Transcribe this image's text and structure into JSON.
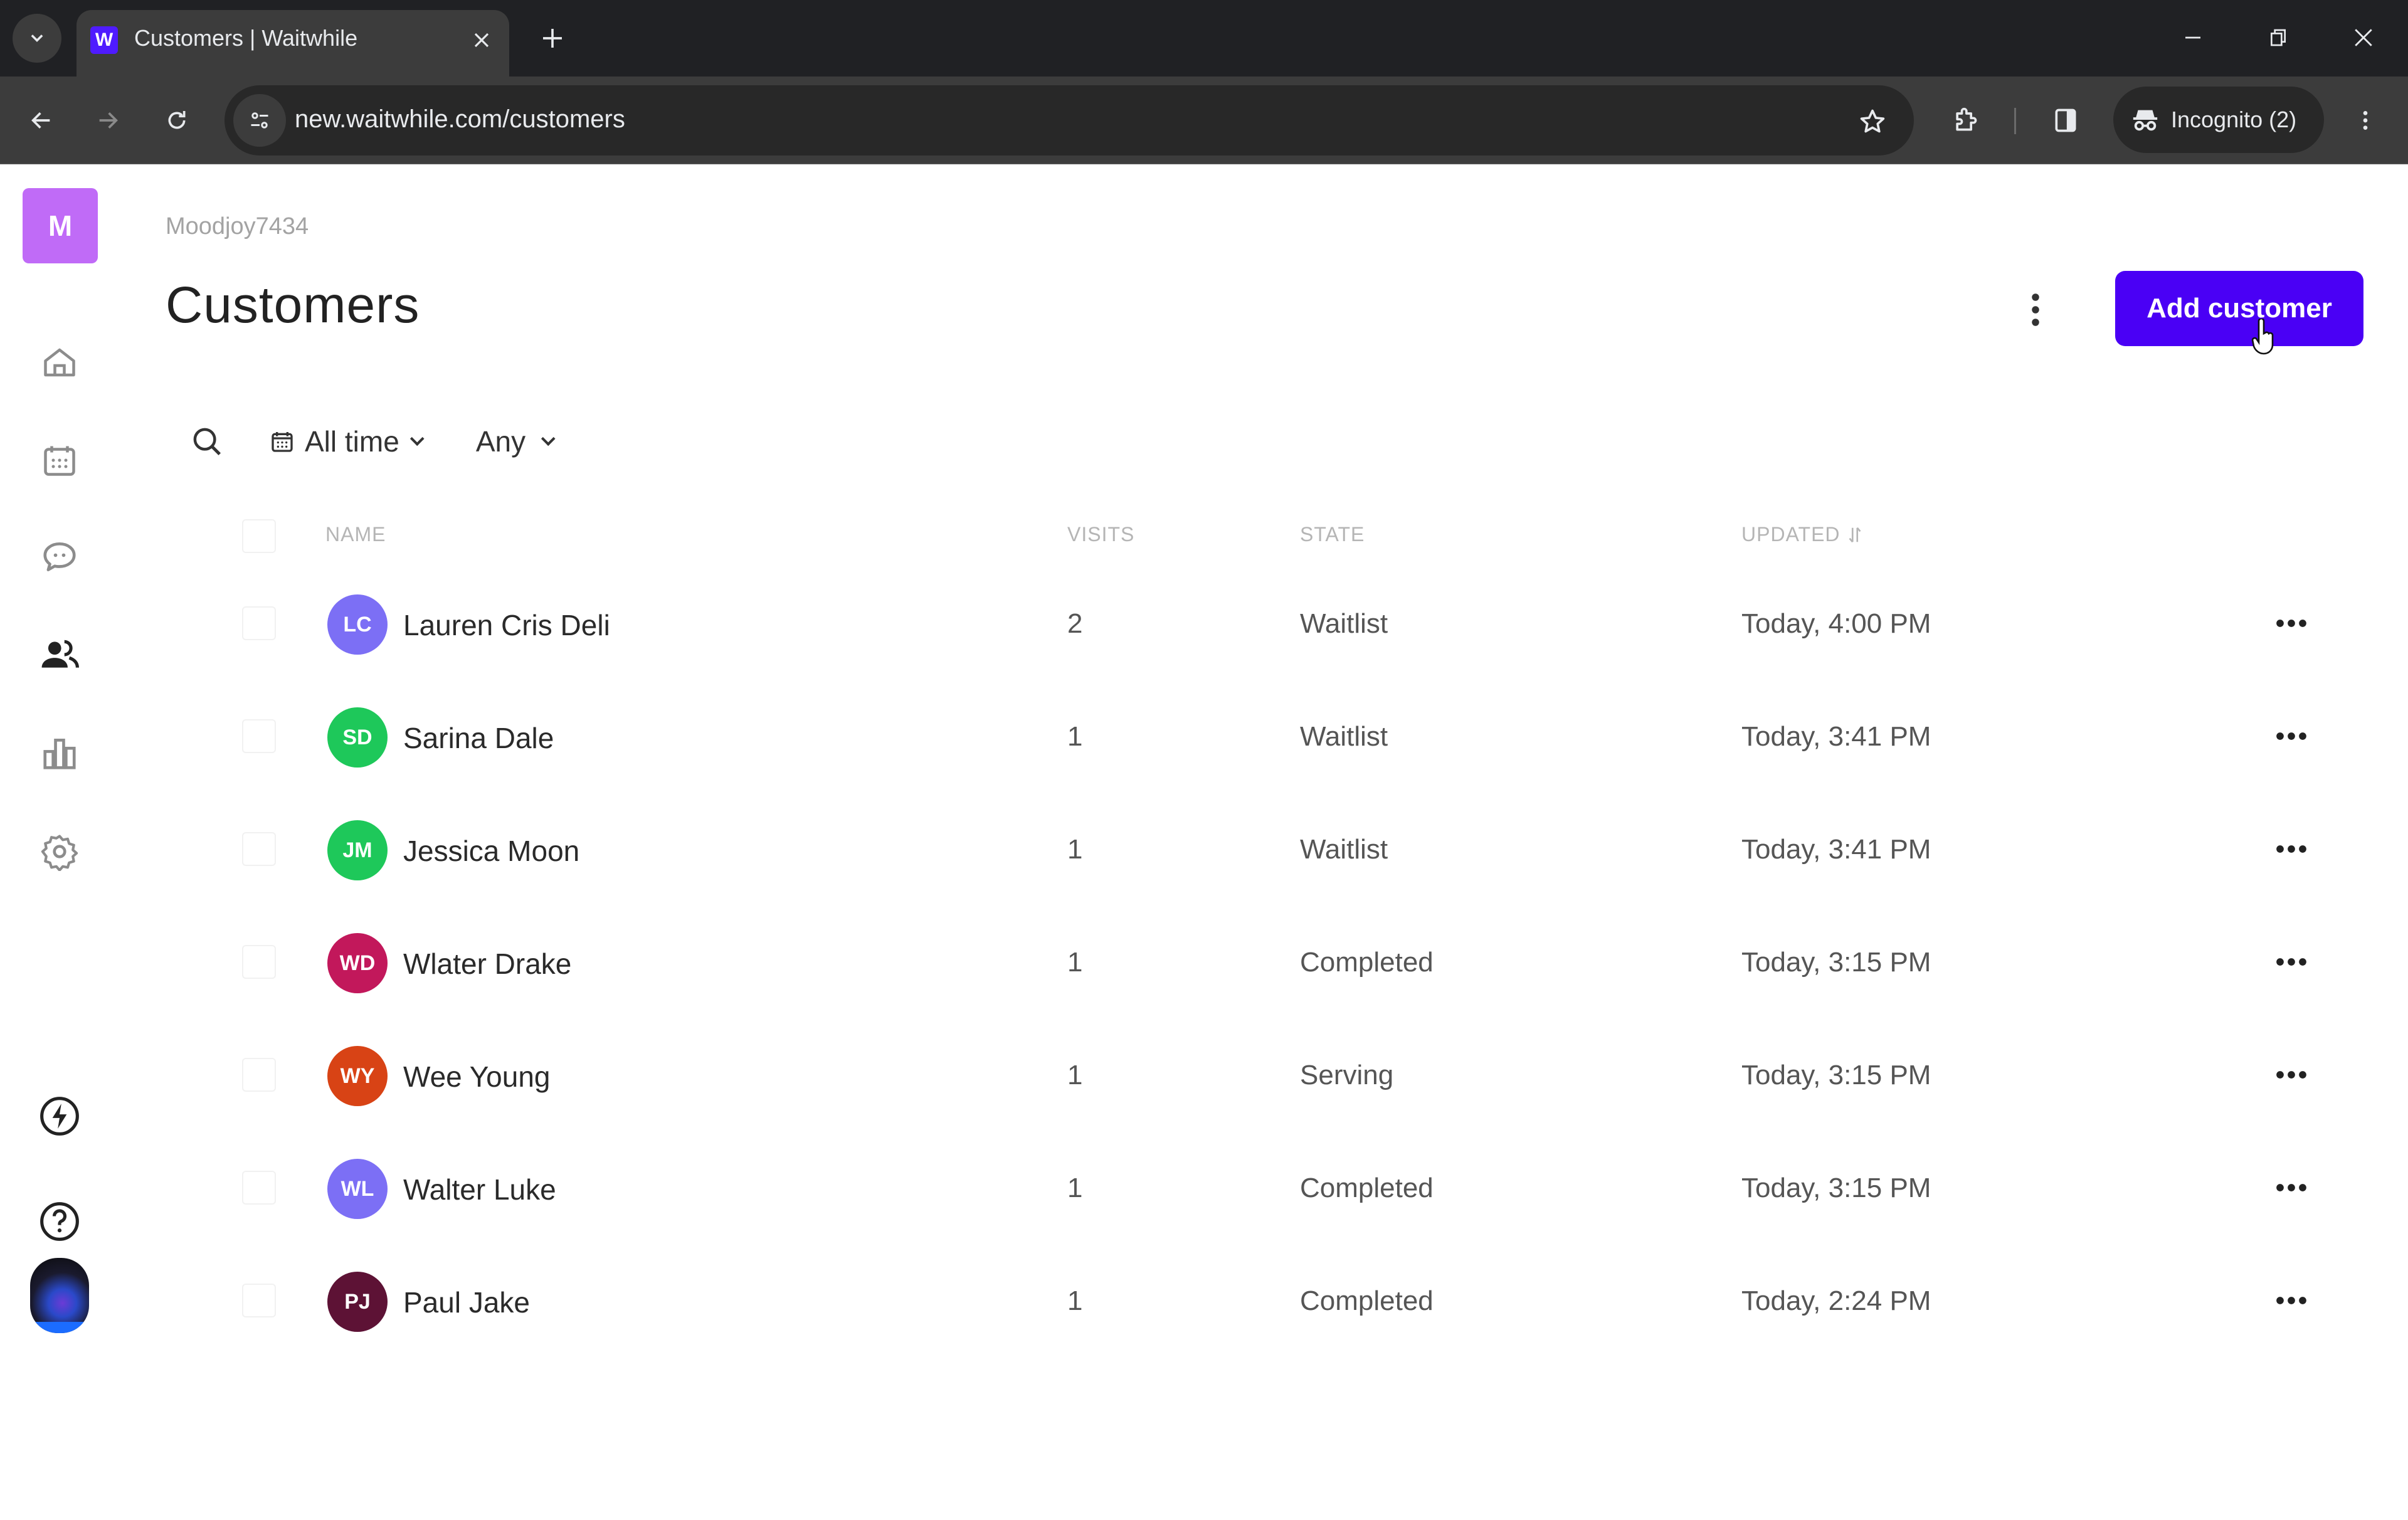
{
  "browser": {
    "tab_title": "Customers | Waitwhile",
    "tab_favicon_letter": "W",
    "url": "new.waitwhile.com/customers",
    "incognito_label": "Incognito (2)",
    "icons": {
      "tab_list": "chevron-down-icon",
      "tab_close": "close-icon",
      "new_tab": "plus-icon",
      "back": "arrow-left-icon",
      "forward": "arrow-right-icon",
      "reload": "reload-icon",
      "site_info": "tune-icon",
      "bookmark": "star-icon",
      "extensions": "puzzle-icon",
      "side_panel": "side-panel-icon",
      "incognito": "incognito-icon",
      "menu": "kebab-icon",
      "minimize": "minimize-icon",
      "restore": "restore-icon",
      "close": "close-icon"
    }
  },
  "sidebar": {
    "org_initial": "M",
    "org_color": "#c06bf7",
    "items": [
      {
        "id": "home",
        "icon": "home-icon",
        "active": false
      },
      {
        "id": "calendar",
        "icon": "calendar-icon",
        "active": false
      },
      {
        "id": "messages",
        "icon": "chat-icon",
        "active": false
      },
      {
        "id": "customers",
        "icon": "users-icon",
        "active": true
      },
      {
        "id": "analytics",
        "icon": "bar-chart-icon",
        "active": false
      },
      {
        "id": "settings",
        "icon": "gear-icon",
        "active": false
      }
    ],
    "bottom_items": [
      {
        "id": "whats-new",
        "icon": "lightning-icon"
      },
      {
        "id": "help",
        "icon": "help-icon"
      },
      {
        "id": "profile",
        "icon": "avatar"
      }
    ]
  },
  "header": {
    "org_name": "Moodjoy7434",
    "title": "Customers",
    "more_icon": "kebab-icon",
    "add_button_label": "Add customer",
    "accent_color": "#4a00f5"
  },
  "filters": {
    "search_icon": "search-icon",
    "date_filter": "All time",
    "state_filter": "Any"
  },
  "table": {
    "columns": {
      "name": "NAME",
      "visits": "VISITS",
      "state": "STATE",
      "updated": "UPDATED"
    },
    "sort_icon": "sort-icon",
    "rows": [
      {
        "initials": "LC",
        "color": "#7c6ff5",
        "name": "Lauren Cris Deli",
        "visits": "2",
        "state": "Waitlist",
        "updated": "Today, 4:00 PM"
      },
      {
        "initials": "SD",
        "color": "#1ec85a",
        "name": "Sarina Dale",
        "visits": "1",
        "state": "Waitlist",
        "updated": "Today, 3:41 PM"
      },
      {
        "initials": "JM",
        "color": "#1ec85a",
        "name": "Jessica Moon",
        "visits": "1",
        "state": "Waitlist",
        "updated": "Today, 3:41 PM"
      },
      {
        "initials": "WD",
        "color": "#c2185b",
        "name": "Wlater Drake",
        "visits": "1",
        "state": "Completed",
        "updated": "Today, 3:15 PM"
      },
      {
        "initials": "WY",
        "color": "#d84315",
        "name": "Wee Young",
        "visits": "1",
        "state": "Serving",
        "updated": "Today, 3:15 PM"
      },
      {
        "initials": "WL",
        "color": "#7c6ff5",
        "name": "Walter Luke",
        "visits": "1",
        "state": "Completed",
        "updated": "Today, 3:15 PM"
      },
      {
        "initials": "PJ",
        "color": "#5d1235",
        "name": "Paul Jake",
        "visits": "1",
        "state": "Completed",
        "updated": "Today, 2:24 PM"
      }
    ]
  }
}
